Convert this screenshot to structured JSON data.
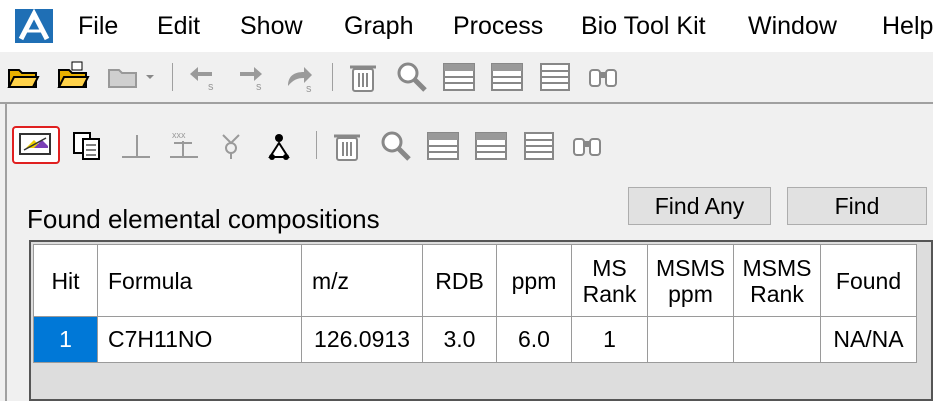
{
  "menu": {
    "items": [
      "File",
      "Edit",
      "Show",
      "Graph",
      "Process",
      "Bio Tool Kit",
      "Window",
      "Help"
    ]
  },
  "colors": {
    "accent": "#0078d7",
    "highlight_border": "#e02020",
    "app_icon": "#1f6fb5"
  },
  "toolbar_top": {
    "icons": [
      "open-folder-icon",
      "open-folder-alt-icon",
      "folder-dropdown-icon",
      "undo-arrow-icon",
      "redo-arrow-icon",
      "curved-arrow-icon",
      "trash-icon",
      "magnifier-icon",
      "table-view-icon",
      "table-view-alt-icon",
      "list-view-icon",
      "binoculars-icon"
    ]
  },
  "toolbar_panel": {
    "icons": [
      "formula-editor-icon",
      "copy-icon",
      "baseline-icon",
      "xxx-marker-icon",
      "filter-icon",
      "person-spectrum-icon",
      "trash-icon",
      "magnifier-icon",
      "table-view-icon",
      "table-view-alt-icon",
      "list-view-icon",
      "binoculars-icon"
    ]
  },
  "buttons": {
    "find_any": "Find Any",
    "find": "Find"
  },
  "found_title": "Found elemental compositions",
  "table": {
    "headers": {
      "hit": "Hit",
      "formula": "Formula",
      "mz": "m/z",
      "rdb": "RDB",
      "ppm": "ppm",
      "ms_rank_1": "MS",
      "ms_rank_2": "Rank",
      "msms_ppm_1": "MSMS",
      "msms_ppm_2": "ppm",
      "msms_rank_1": "MSMS",
      "msms_rank_2": "Rank",
      "found": "Found"
    },
    "rows": [
      {
        "hit": "1",
        "formula": "C7H11NO",
        "mz": "126.0913",
        "rdb": "3.0",
        "ppm": "6.0",
        "ms_rank": "1",
        "msms_ppm": "",
        "msms_rank": "",
        "found": "NA/NA"
      }
    ]
  }
}
